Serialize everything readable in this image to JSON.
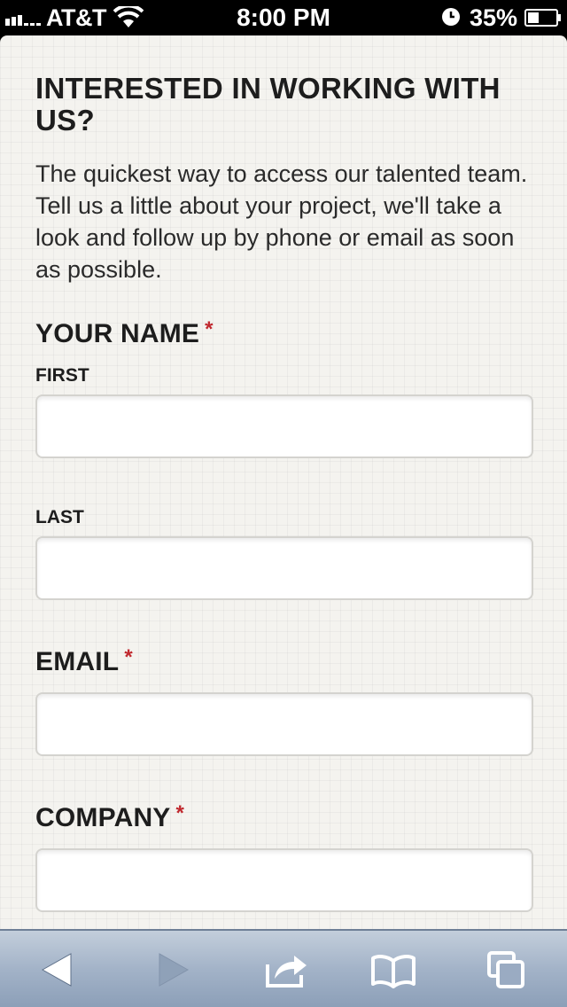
{
  "status_bar": {
    "carrier": "AT&T",
    "time": "8:00 PM",
    "battery": "35%",
    "icons": [
      "signal-icon",
      "wifi-icon",
      "alarm-icon",
      "battery-icon"
    ]
  },
  "form": {
    "title": "INTERESTED IN WORKING WITH US?",
    "intro": "The quickest way to access our talented team. Tell us a little about your project, we'll take a look and follow up by phone or email as soon as possible.",
    "required_mark": "*",
    "name_label": "YOUR NAME",
    "first_label": "FIRST",
    "first_value": "",
    "last_label": "LAST",
    "last_value": "",
    "email_label": "EMAIL",
    "email_value": "",
    "company_label": "COMPANY",
    "company_value": ""
  },
  "toolbar": {
    "icons": [
      "back-arrow-icon",
      "forward-arrow-icon",
      "share-icon",
      "bookmarks-icon",
      "tabs-icon"
    ]
  },
  "colors": {
    "page_bg": "#f4f3ef",
    "required": "#c0282e",
    "toolbar": "#a3b3c8"
  }
}
